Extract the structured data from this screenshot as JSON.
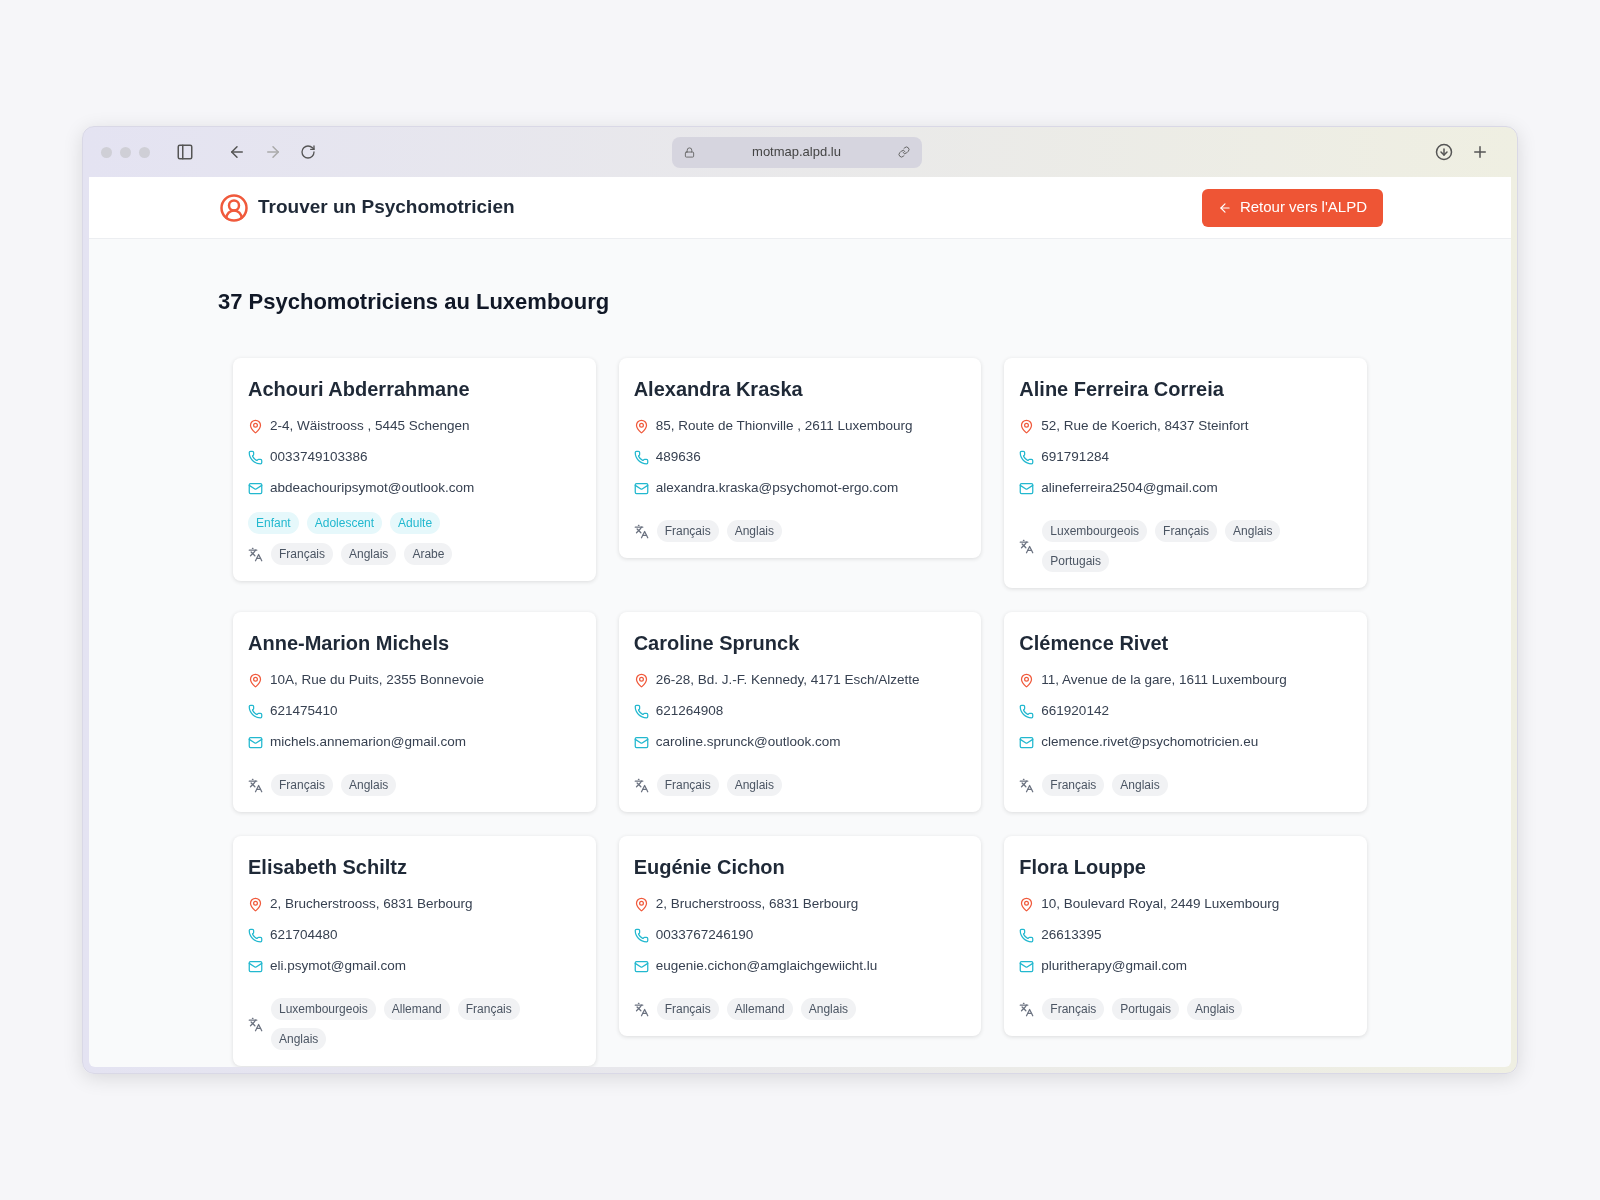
{
  "browser": {
    "url": "motmap.alpd.lu"
  },
  "header": {
    "title": "Trouver un Psychomotricien",
    "back_button": "Retour vers l'ALPD"
  },
  "heading": "37 Psychomotriciens au Luxembourg",
  "cards": [
    {
      "name": "Achouri Abderrahmane",
      "address": "2-4, Wäistrooss , 5445 Schengen",
      "phone": "0033749103386",
      "email": "abdeachouripsymot@outlook.com",
      "age_groups": [
        "Enfant",
        "Adolescent",
        "Adulte"
      ],
      "languages": [
        "Français",
        "Anglais",
        "Arabe"
      ]
    },
    {
      "name": "Alexandra Kraska",
      "address": "85, Route de Thionville , 2611 Luxembourg",
      "phone": "489636",
      "email": "alexandra.kraska@psychomot-ergo.com",
      "languages": [
        "Français",
        "Anglais"
      ]
    },
    {
      "name": "Aline Ferreira Correia",
      "address": "52, Rue de Koerich, 8437 Steinfort",
      "phone": "691791284",
      "email": "alineferreira2504@gmail.com",
      "languages": [
        "Luxembourgeois",
        "Français",
        "Anglais",
        "Portugais"
      ]
    },
    {
      "name": "Anne-Marion Michels",
      "address": "10A, Rue du Puits, 2355 Bonnevoie",
      "phone": "621475410",
      "email": "michels.annemarion@gmail.com",
      "languages": [
        "Français",
        "Anglais"
      ]
    },
    {
      "name": "Caroline Sprunck",
      "address": "26-28, Bd. J.-F. Kennedy, 4171 Esch/Alzette",
      "phone": "621264908",
      "email": "caroline.sprunck@outlook.com",
      "languages": [
        "Français",
        "Anglais"
      ]
    },
    {
      "name": "Clémence Rivet",
      "address": "11, Avenue de la gare, 1611 Luxembourg",
      "phone": "661920142",
      "email": "clemence.rivet@psychomotricien.eu",
      "languages": [
        "Français",
        "Anglais"
      ]
    },
    {
      "name": "Elisabeth Schiltz",
      "address": "2, Brucherstrooss, 6831 Berbourg",
      "phone": "621704480",
      "email": "eli.psymot@gmail.com",
      "languages": [
        "Luxembourgeois",
        "Allemand",
        "Français",
        "Anglais"
      ]
    },
    {
      "name": "Eugénie Cichon",
      "address": "2, Brucherstrooss, 6831 Berbourg",
      "phone": "0033767246190",
      "email": "eugenie.cichon@amglaichgewiicht.lu",
      "languages": [
        "Français",
        "Allemand",
        "Anglais"
      ]
    },
    {
      "name": "Flora Louppe",
      "address": "10, Boulevard Royal, 2449 Luxembourg",
      "phone": "26613395",
      "email": "pluritherapy@gmail.com",
      "languages": [
        "Français",
        "Portugais",
        "Anglais"
      ]
    }
  ]
}
